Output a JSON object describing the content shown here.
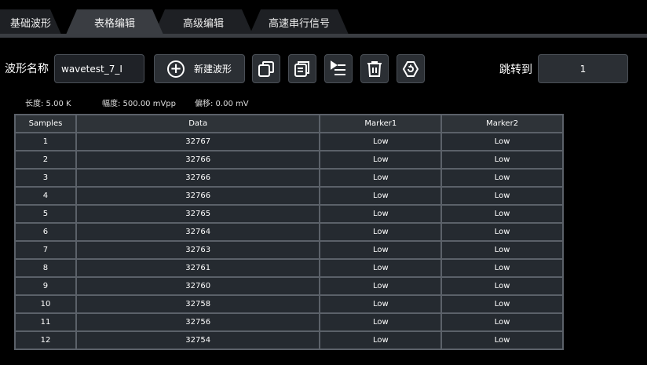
{
  "tabs": [
    {
      "label": "基础波形"
    },
    {
      "label": "表格编辑"
    },
    {
      "label": "高级编辑"
    },
    {
      "label": "高速串行信号"
    }
  ],
  "toolbar": {
    "name_label": "波形名称",
    "name_value": "wavetest_7_I",
    "new_wave_label": "新建波形",
    "jump_label": "跳转到",
    "jump_value": "1",
    "icons": [
      "copy-icon",
      "paste-icon",
      "insert-icon",
      "delete-icon",
      "settings-icon"
    ]
  },
  "info": {
    "length": "长度: 5.00 K",
    "amplitude": "幅度: 500.00 mVpp",
    "offset": "偏移: 0.00 mV"
  },
  "table": {
    "headers": [
      "Samples",
      "Data",
      "Marker1",
      "Marker2"
    ],
    "rows": [
      [
        "1",
        "32767",
        "Low",
        "Low"
      ],
      [
        "2",
        "32766",
        "Low",
        "Low"
      ],
      [
        "3",
        "32766",
        "Low",
        "Low"
      ],
      [
        "4",
        "32766",
        "Low",
        "Low"
      ],
      [
        "5",
        "32765",
        "Low",
        "Low"
      ],
      [
        "6",
        "32764",
        "Low",
        "Low"
      ],
      [
        "7",
        "32763",
        "Low",
        "Low"
      ],
      [
        "8",
        "32761",
        "Low",
        "Low"
      ],
      [
        "9",
        "32760",
        "Low",
        "Low"
      ],
      [
        "10",
        "32758",
        "Low",
        "Low"
      ],
      [
        "11",
        "32756",
        "Low",
        "Low"
      ],
      [
        "12",
        "32754",
        "Low",
        "Low"
      ]
    ]
  },
  "colors": {
    "active_tab": "#3a3d42",
    "inactive_tab": "#1e2024",
    "table_border": "#5b6169",
    "table_bg": "#252a30"
  }
}
